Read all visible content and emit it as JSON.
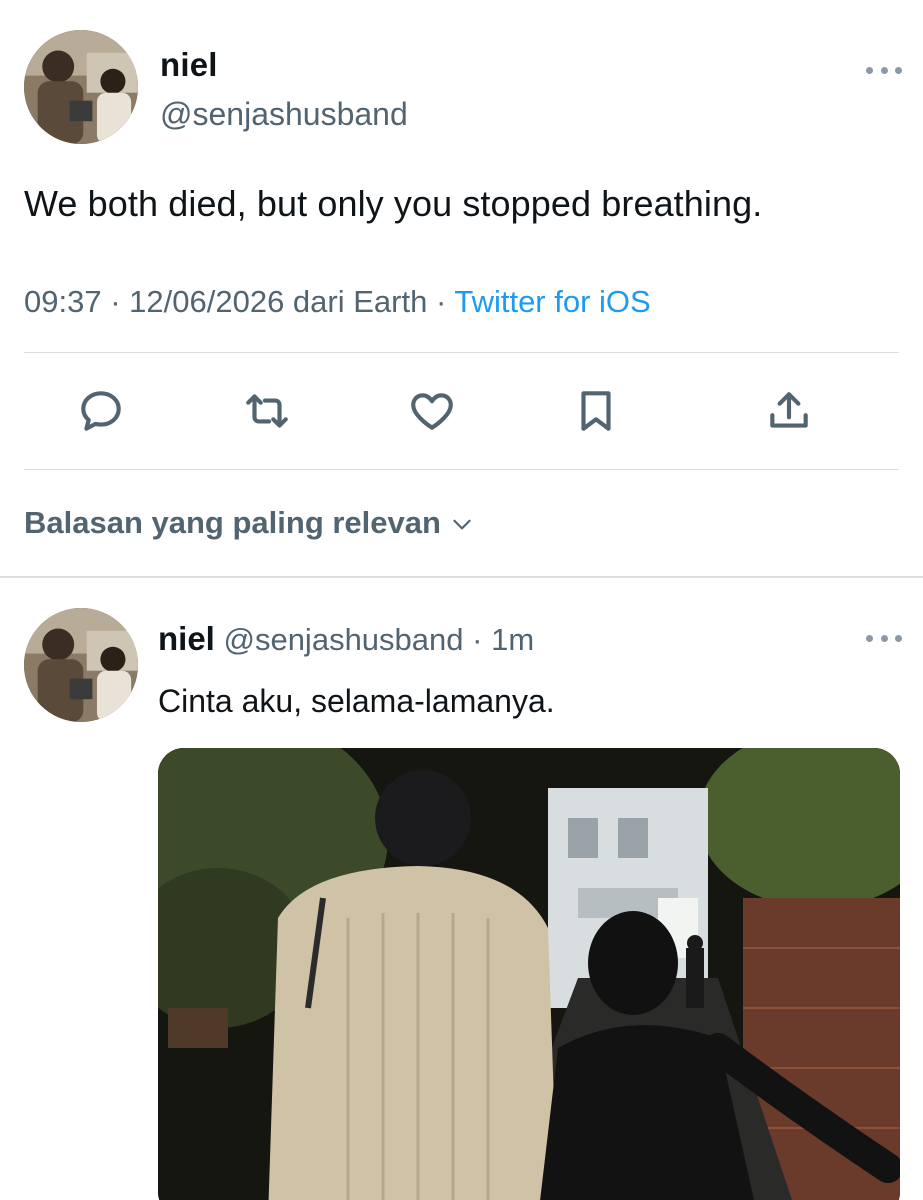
{
  "main_tweet": {
    "display_name": "niel",
    "handle": "@senjashusband",
    "text": "We both died, but only you stopped breathing.",
    "time": "09:37",
    "separator": "·",
    "date_place": "12/06/2026 dari Earth",
    "source": "Twitter for iOS",
    "actions": {
      "reply_icon": "reply-icon",
      "retweet_icon": "retweet-icon",
      "like_icon": "heart-icon",
      "bookmark_icon": "bookmark-icon",
      "share_icon": "share-icon"
    }
  },
  "replies_sort": {
    "label": "Balasan yang paling relevan",
    "icon": "chevron-down-icon"
  },
  "reply_tweet": {
    "display_name": "niel",
    "handle": "@senjashusband",
    "separator": "·",
    "time": "1m",
    "text": "Cinta aku, selama-lamanya."
  },
  "colors": {
    "text_primary": "#0f1419",
    "text_secondary": "#536471",
    "link_blue": "#1d9bf0",
    "divider": "#d9dfe3"
  }
}
